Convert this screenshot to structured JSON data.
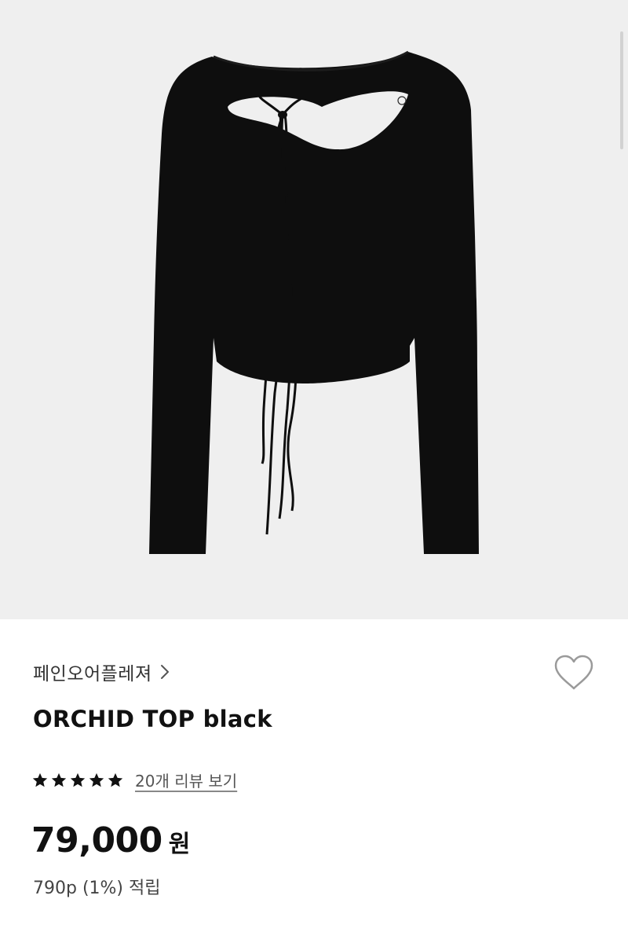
{
  "product": {
    "brand": "페인오어플레져",
    "name": "ORCHID TOP black",
    "rating_stars": 5,
    "review_link": "20개 리뷰 보기",
    "price": "79,000",
    "currency": "원",
    "points": "790p (1%) 적립"
  },
  "icons": {
    "brand_arrow": "chevron-right-icon",
    "wishlist": "heart-outline-icon",
    "rating": "star-icon"
  },
  "colors": {
    "hero_background": "#efefef",
    "garment": "#0e0e0e",
    "text_primary": "#111111",
    "text_secondary": "#555555"
  }
}
